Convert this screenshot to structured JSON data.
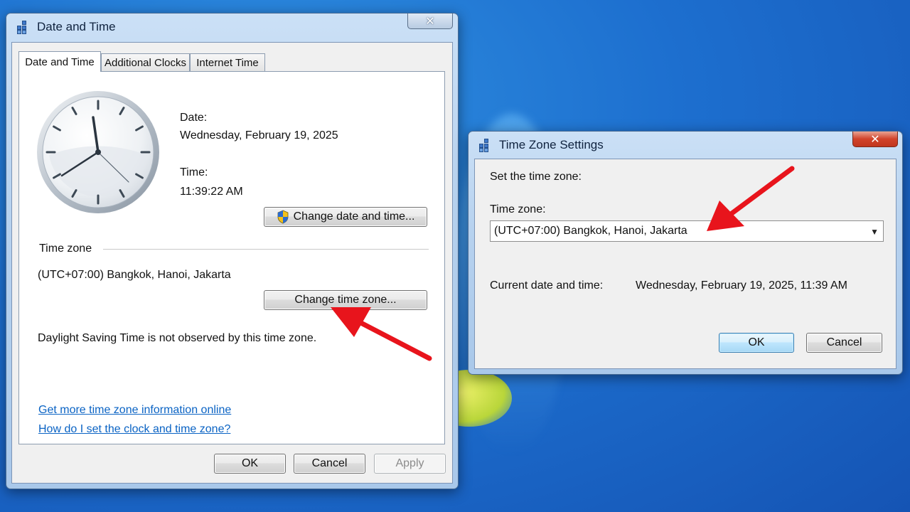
{
  "date_time_window": {
    "title": "Date and Time",
    "close_glyph": "✕",
    "tabs": [
      "Date and Time",
      "Additional Clocks",
      "Internet Time"
    ],
    "date_label": "Date:",
    "date_value": "Wednesday, February 19, 2025",
    "time_label": "Time:",
    "time_value": "11:39:22 AM",
    "change_datetime_button": "Change date and time...",
    "timezone_group_label": "Time zone",
    "timezone_value": "(UTC+07:00) Bangkok, Hanoi, Jakarta",
    "change_timezone_button": "Change time zone...",
    "dst_note": "Daylight Saving Time is not observed by this time zone.",
    "link_more_info": "Get more time zone information online",
    "link_how_to": "How do I set the clock and time zone?",
    "ok_button": "OK",
    "cancel_button": "Cancel",
    "apply_button": "Apply"
  },
  "timezone_window": {
    "title": "Time Zone Settings",
    "close_glyph": "✕",
    "prompt": "Set the time zone:",
    "timezone_label": "Time zone:",
    "timezone_selected": "(UTC+07:00) Bangkok, Hanoi, Jakarta",
    "current_label": "Current date and time:",
    "current_value": "Wednesday, February 19, 2025, 11:39 AM",
    "ok_button": "OK",
    "cancel_button": "Cancel"
  },
  "icons": {
    "clock": "analog-clock-icon",
    "shield": "uac-shield-icon",
    "window": "control-panel-icon",
    "arrow": "red-arrow"
  },
  "colors": {
    "annotation_arrow": "#e8141c",
    "link": "#0a63c4",
    "desktop": "#1d6fcf"
  }
}
